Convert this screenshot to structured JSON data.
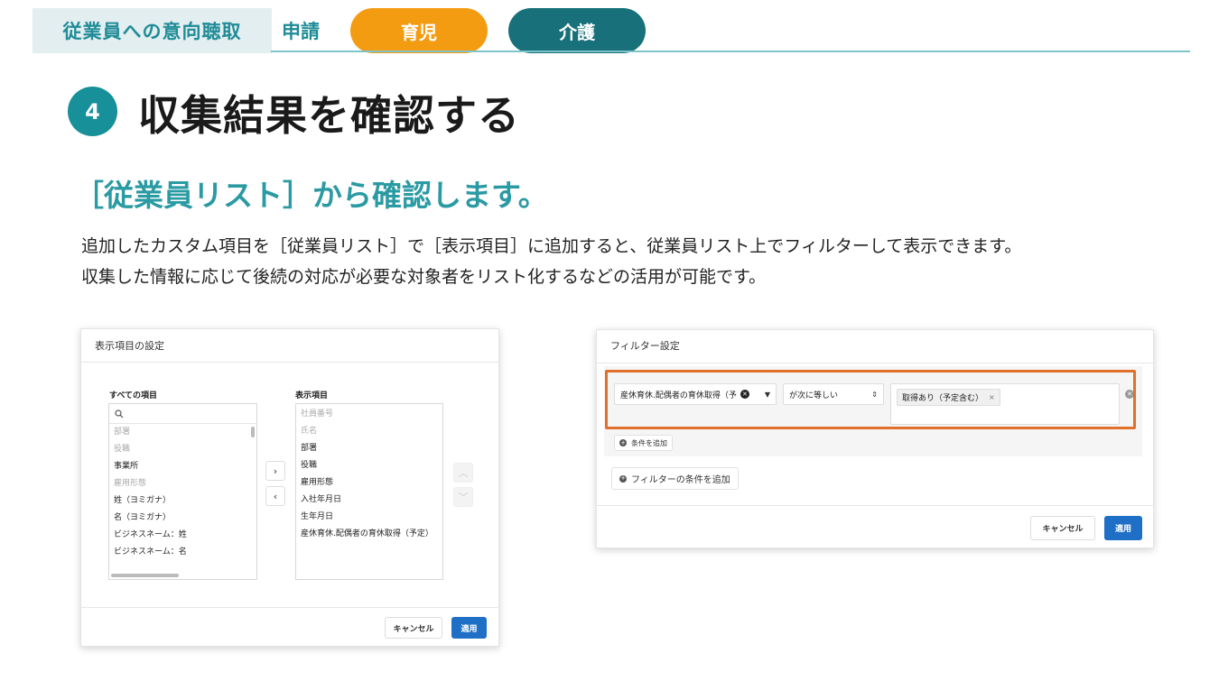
{
  "header": {
    "section_label": "従業員への意向聴取",
    "apply_label": "申請",
    "tabs": [
      {
        "label": "育児",
        "color": "#f39c12"
      },
      {
        "label": "介護",
        "color": "#17707a"
      }
    ]
  },
  "step": {
    "number": "4",
    "title": "収集結果を確認する"
  },
  "subheading": "［従業員リスト］から確認します。",
  "body": {
    "line1": "追加したカスタム項目を［従業員リスト］で［表示項目］に追加すると、従業員リスト上でフィルターして表示できます。",
    "line2": "収集した情報に応じて後続の対応が必要な対象者をリスト化するなどの活用が可能です。"
  },
  "display_dialog": {
    "title": "表示項目の設定",
    "all_items_label": "すべての項目",
    "all_items": [
      {
        "label": "部署",
        "disabled": true
      },
      {
        "label": "役職",
        "disabled": true
      },
      {
        "label": "事業所",
        "disabled": false
      },
      {
        "label": "雇用形態",
        "disabled": true
      },
      {
        "label": "姓（ヨミガナ）",
        "disabled": false
      },
      {
        "label": "名（ヨミガナ）",
        "disabled": false
      },
      {
        "label": "ビジネスネーム：姓",
        "disabled": false
      },
      {
        "label": "ビジネスネーム：名",
        "disabled": false
      }
    ],
    "shown_items_label": "表示項目",
    "shown_items": [
      {
        "label": "社員番号",
        "disabled": true
      },
      {
        "label": "氏名",
        "disabled": true
      },
      {
        "label": "部署",
        "disabled": false
      },
      {
        "label": "役職",
        "disabled": false
      },
      {
        "label": "雇用形態",
        "disabled": false
      },
      {
        "label": "入社年月日",
        "disabled": false
      },
      {
        "label": "生年月日",
        "disabled": false
      },
      {
        "label": "産休育休.配偶者の育休取得（予定）",
        "disabled": false
      }
    ],
    "move_right": "›",
    "move_left": "‹",
    "move_up": "︿",
    "move_down": "﹀",
    "cancel": "キャンセル",
    "apply": "適用"
  },
  "filter_dialog": {
    "title": "フィルター設定",
    "field_value": "産休育休.配偶者の育休取得（予",
    "operator_value": "が次に等しい",
    "tag_value": "取得あり（予定含む）",
    "add_condition": "条件を追加",
    "add_filter_condition": "フィルターの条件を追加",
    "cancel": "キャンセル",
    "apply": "適用",
    "highlight_color": "#e0702a"
  },
  "colors": {
    "accent_teal": "#1f8c97",
    "apply_blue": "#1e6fc5"
  }
}
